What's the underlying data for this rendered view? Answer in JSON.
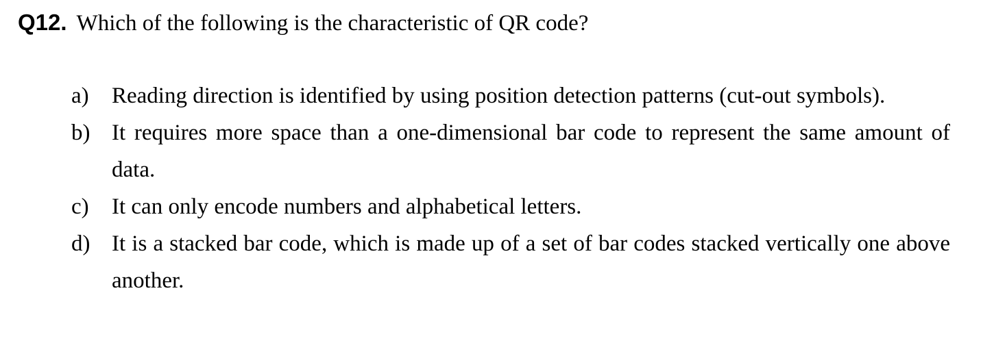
{
  "question": {
    "number": "Q12.",
    "text": "Which of the following is the characteristic of QR code?"
  },
  "options": [
    {
      "letter": "a)",
      "text": "Reading direction is identified by using position detection patterns (cut-out symbols)."
    },
    {
      "letter": "b)",
      "text": "It requires more space than a one-dimensional bar code to represent the same amount of data."
    },
    {
      "letter": "c)",
      "text": "It can only encode numbers and alphabetical letters."
    },
    {
      "letter": "d)",
      "text": "It is a stacked bar code, which is made up of a set of bar codes stacked vertically one above another."
    }
  ]
}
